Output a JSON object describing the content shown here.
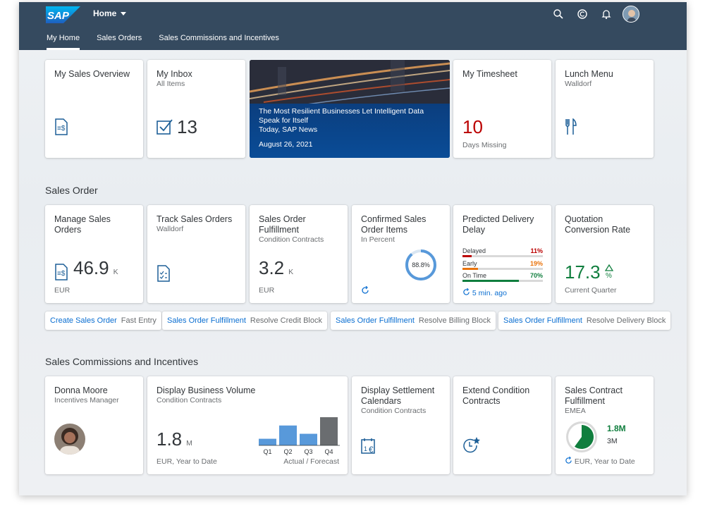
{
  "header": {
    "logo_text": "SAP",
    "home_label": "Home",
    "icons": [
      "search-icon",
      "help-icon",
      "bell-icon",
      "user-avatar"
    ]
  },
  "tabs": [
    {
      "label": "My Home",
      "active": true
    },
    {
      "label": "Sales Orders",
      "active": false
    },
    {
      "label": "Sales Commissions and Incentives",
      "active": false
    }
  ],
  "home_tiles": {
    "sales_overview": {
      "title": "My Sales Overview",
      "icon": "sales-document-icon"
    },
    "inbox": {
      "title": "My Inbox",
      "subtitle": "All Items",
      "count": "13",
      "icon": "checkbox-icon"
    },
    "news": {
      "headline": "The Most Resilient Businesses Let Intelligent Data Speak for Itself",
      "source": "Today, SAP News",
      "date": "August 26, 2021"
    },
    "timesheet": {
      "title": "My Timesheet",
      "value": "10",
      "footer": "Days Missing"
    },
    "lunch": {
      "title": "Lunch Menu",
      "subtitle": "Walldorf",
      "icon": "cutlery-icon"
    }
  },
  "sales_order": {
    "section_title": "Sales Order",
    "manage": {
      "title": "Manage Sales Orders",
      "value": "46.9",
      "unit": "K",
      "footer": "EUR"
    },
    "track": {
      "title": "Track Sales Orders",
      "subtitle": "Walldorf"
    },
    "fulfillment": {
      "title": "Sales Order Fulfillment",
      "subtitle": "Condition Contracts",
      "value": "3.2",
      "unit": "K",
      "footer": "EUR"
    },
    "confirmed": {
      "title": "Confirmed Sales Order Items",
      "subtitle": "In Percent",
      "value": "88.8%",
      "percent": 88.8
    },
    "predicted": {
      "title": "Predicted Delivery Delay",
      "rows": [
        {
          "label": "Delayed",
          "pct": "11%",
          "value": 11,
          "color": "#bb0000"
        },
        {
          "label": "Early",
          "pct": "19%",
          "value": 19,
          "color": "#e9730c"
        },
        {
          "label": "On Time",
          "pct": "70%",
          "value": 70,
          "color": "#107e3e"
        }
      ],
      "refresh": "5 min. ago"
    },
    "quotation": {
      "title": "Quotation Conversion Rate",
      "value": "17.3",
      "unit": "%",
      "footer": "Current Quarter"
    }
  },
  "links": [
    {
      "main": "Create Sales Order",
      "sub": "Fast Entry"
    },
    {
      "main": "Sales Order Fulfillment",
      "sub": "Resolve Credit Block"
    },
    {
      "main": "Sales Order Fulfillment",
      "sub": "Resolve Billing Block"
    },
    {
      "main": "Sales Order Fulfillment",
      "sub": "Resolve Delivery Block"
    }
  ],
  "commissions": {
    "section_title": "Sales Commissions and Incentives",
    "person": {
      "name": "Donna Moore",
      "role": "Incentives Manager"
    },
    "business_volume": {
      "title": "Display Business Volume",
      "subtitle": "Condition Contracts",
      "value": "1.8",
      "unit": "M",
      "footer_left": "EUR, Year to Date",
      "footer_right": "Actual / Forecast"
    },
    "settlement": {
      "title": "Display Settlement Calendars",
      "subtitle": "Condition Contracts"
    },
    "extend": {
      "title": "Extend Condition Contracts"
    },
    "contract": {
      "title": "Sales Contract Fulfillment",
      "subtitle": "EMEA",
      "actual": "1.8M",
      "target": "3M",
      "footer": "EUR, Year to Date",
      "fraction": 0.6
    }
  },
  "chart_data": {
    "type": "bar",
    "categories": [
      "Q1",
      "Q2",
      "Q3",
      "Q4"
    ],
    "values": [
      0.4,
      1.2,
      0.7,
      1.7
    ],
    "colors": [
      "#5899da",
      "#5899da",
      "#5899da",
      "#6a6d70"
    ],
    "xlabel": "",
    "ylabel": ""
  }
}
